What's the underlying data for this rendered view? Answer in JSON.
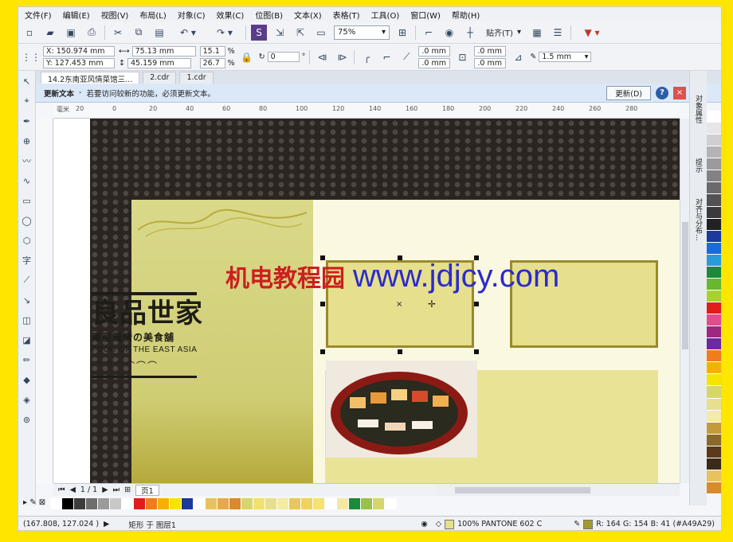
{
  "menu": [
    "文件(F)",
    "编辑(E)",
    "视图(V)",
    "布局(L)",
    "对象(C)",
    "效果(C)",
    "位图(B)",
    "文本(X)",
    "表格(T)",
    "工具(O)",
    "窗口(W)",
    "帮助(H)"
  ],
  "toolbar": {
    "zoom": "75%",
    "snap_label": "贴齐(T)"
  },
  "props": {
    "x": "X: 150.974 mm",
    "y": "Y: 127.453 mm",
    "w": "75.13 mm",
    "h": "45.159 mm",
    "sx": "15.1",
    "sy": "26.7",
    "pct": "%",
    "angle": "0",
    "deg": "°",
    "corner1": ".0 mm",
    "corner2": ".0 mm",
    "corner3": ".0 mm",
    "corner4": ".0 mm",
    "outline": "1.5 mm"
  },
  "tabs": [
    "14.2东南亚风情菜馆三...",
    "2.cdr",
    "1.cdr"
  ],
  "notice": {
    "title": "更新文本",
    "dash": "-",
    "message": "若要访问较新的功能，必须更新文本。",
    "button": "更新(D)",
    "help": "?",
    "close": "×"
  },
  "ruler": {
    "h_ticks": [
      "20",
      "0",
      "20",
      "40",
      "60",
      "80",
      "100",
      "120",
      "140",
      "160",
      "180",
      "200",
      "220",
      "240",
      "260",
      "280"
    ],
    "unit": "毫米"
  },
  "design": {
    "title": "良品世家",
    "subtitle": "東亞風情の美食舖",
    "english": "FOOD OF THE EAST ASIA",
    "icons": "⌒⌒⌒⌒⌒⌒",
    "watermark_cn": "机电教程园",
    "watermark_url": "www.jdjcy.com"
  },
  "pagenav": {
    "count": "1 / 1",
    "page": "页1"
  },
  "dockers": [
    "对象属性",
    "提示",
    "对齐与分布..."
  ],
  "status": {
    "coords": "(167.808, 127.024 )",
    "object": "矩形 于 图层1",
    "fill": "100% PANTONE 602 C",
    "color": "R: 164 G: 154 B: 41 (#A49A29)"
  },
  "palette_h": [
    "#ffffff",
    "#000000",
    "#3c3c3c",
    "#6e6e6e",
    "#9b9b9b",
    "#c8c8c8",
    "#ffffff",
    "#e21b1b",
    "#f07c1a",
    "#f6b100",
    "#f6e400",
    "#1b3a9b",
    "#ffffff",
    "#e8c25c",
    "#e6a94a",
    "#d98a2d",
    "#d6d66c",
    "#f2e26b",
    "#e6df8d",
    "#f4eba5",
    "#e7c75b",
    "#f0d35a",
    "#f6e26d",
    "#ffffff",
    "#f3e9a2",
    "#1b8a3a",
    "#9ac14a",
    "#d6d66c",
    "#ffffff"
  ],
  "palette_v": [
    "#ffffff",
    "#e6e6e6",
    "#cfcfcf",
    "#b4b4b4",
    "#9b9b9b",
    "#828282",
    "#6a6a6a",
    "#525252",
    "#3a3a3a",
    "#222222",
    "#1b3a9b",
    "#1b6bd6",
    "#2a9bd9",
    "#1b8a3a",
    "#66b82f",
    "#a9d12d",
    "#e21b1b",
    "#e24c8c",
    "#a0267e",
    "#6a2a9b",
    "#f07c1a",
    "#f6b100",
    "#f6e400",
    "#d6d66c",
    "#e6df8d",
    "#f4eba5",
    "#c49a3a",
    "#8a6a2a",
    "#5a3a1a",
    "#3a2a1a",
    "#e8c25c",
    "#d98a2d"
  ]
}
